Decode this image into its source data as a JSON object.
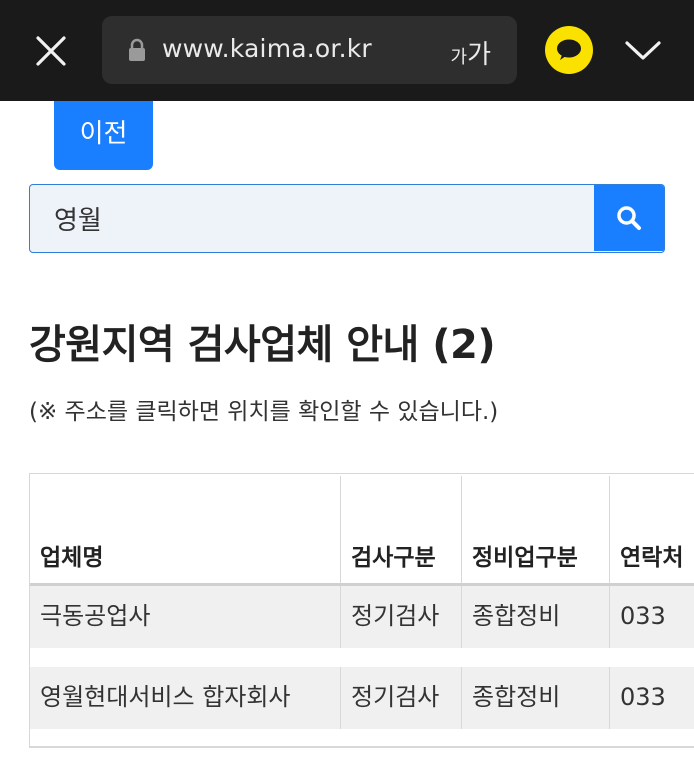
{
  "browser": {
    "url": "www.kaima.or.kr",
    "text_size_label_small": "가",
    "text_size_label_big": "가",
    "icons": [
      "close-icon",
      "lock-icon",
      "kakao-talk-icon",
      "chevron-down-icon"
    ]
  },
  "nav": {
    "prev_label": "이전"
  },
  "search": {
    "value": "영월",
    "icon": "search-icon"
  },
  "page": {
    "title": "강원지역 검사업체 안내 (2)",
    "note": "(※ 주소를 클릭하면 위치를 확인할 수 있습니다.)"
  },
  "table": {
    "headers": [
      "업체명",
      "검사구분",
      "정비업구분",
      "연락처"
    ],
    "rows": [
      [
        "극동공업사",
        "정기검사",
        "종합정비",
        "033"
      ],
      [
        "영월현대서비스 합자회사",
        "정기검사",
        "종합정비",
        "033"
      ]
    ]
  },
  "colors": {
    "topbar_bg": "#1a1a1a",
    "accent_blue": "#1a7fff",
    "kakao_yellow": "#fae100"
  }
}
